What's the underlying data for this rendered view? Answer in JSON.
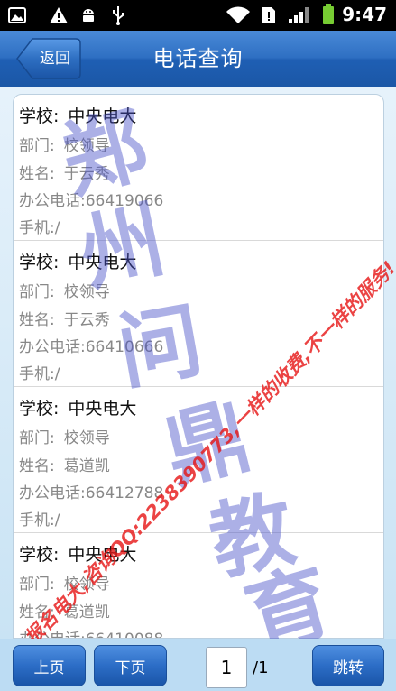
{
  "status_bar": {
    "time": "9:47",
    "icons": [
      "photo-icon",
      "warning-icon",
      "android-debug-icon",
      "usb-icon",
      "wifi-icon",
      "sim-alert-icon",
      "signal-icon",
      "battery-icon"
    ]
  },
  "header": {
    "back_label": "返回",
    "title": "电话查询"
  },
  "entries": [
    {
      "school": "中央电大",
      "department": "校领导",
      "name": "于云秀",
      "office_phone": "66419066",
      "mobile": "/"
    },
    {
      "school": "中央电大",
      "department": "校领导",
      "name": "于云秀",
      "office_phone": "66410666",
      "mobile": "/"
    },
    {
      "school": "中央电大",
      "department": "校领导",
      "name": "葛道凯",
      "office_phone": "66412788",
      "mobile": "/"
    },
    {
      "school": "中央电大",
      "department": "校领导",
      "name": "葛道凯",
      "office_phone": "66410088",
      "mobile": "/"
    }
  ],
  "labels": {
    "school": "学校:",
    "department": "部门:",
    "name": "姓名:",
    "office_phone": "办公电话:",
    "mobile": "手机:"
  },
  "pager": {
    "prev_label": "上页",
    "next_label": "下页",
    "current_page": "1",
    "total": "/1",
    "jump_label": "跳转"
  },
  "watermark": {
    "chars": [
      "郑",
      "州",
      "问",
      "鼎",
      "教",
      "育"
    ],
    "line": "报名电大,咨询QQ:2238390773,一样的收费,不一样的服务!"
  },
  "colors": {
    "header_blue": "#2e6fc2",
    "watermark_blue": "#4650c8",
    "watermark_red": "#e61414"
  }
}
